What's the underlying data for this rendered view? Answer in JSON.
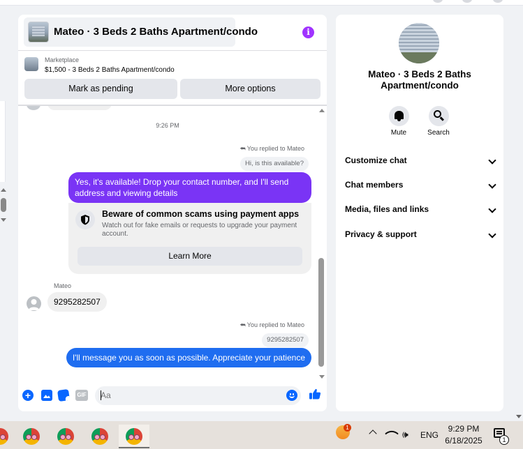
{
  "chat": {
    "title": "Mateo · 3 Beds 2 Baths Apartment/condo",
    "info_icon": "i"
  },
  "marketplace": {
    "label": "Marketplace",
    "listing": "$1,500 - 3 Beds 2 Baths Apartment/condo",
    "mark_pending_label": "Mark as pending",
    "more_options_label": "More options"
  },
  "messages": {
    "timestamp": "9:26 PM",
    "reply_label_1": "You replied to Mateo",
    "quoted_1": "Hi, is this available?",
    "outgoing_1": "Yes, it's available! Drop your contact number, and I'll send address and viewing details",
    "scam_title": "Beware of common scams using payment apps",
    "scam_body": "Watch out for fake emails or requests to upgrade your payment account.",
    "learn_more_label": "Learn More",
    "sender_name": "Mateo",
    "incoming_1": "9295282507",
    "reply_label_2": "You replied to Mateo",
    "quoted_2": "9295282507",
    "outgoing_2": "I'll message you as soon as possible. Appreciate your patience"
  },
  "composer": {
    "placeholder": "Aa",
    "gif_label": "GIF"
  },
  "details": {
    "name": "Mateo · 3 Beds 2 Baths Apartment/condo",
    "mute_label": "Mute",
    "search_label": "Search",
    "sections": [
      {
        "label": "Customize chat"
      },
      {
        "label": "Chat members"
      },
      {
        "label": "Media, files and links"
      },
      {
        "label": "Privacy & support"
      }
    ]
  },
  "taskbar": {
    "language": "ENG",
    "time": "9:29 PM",
    "date": "6/18/2025",
    "weather_badge": "1",
    "notification_badge": "1"
  },
  "colors": {
    "outgoing_purple": "#7a34f5",
    "outgoing_blue": "#1f6df0",
    "accent": "#0866ff",
    "info_button": "#a033ff"
  }
}
